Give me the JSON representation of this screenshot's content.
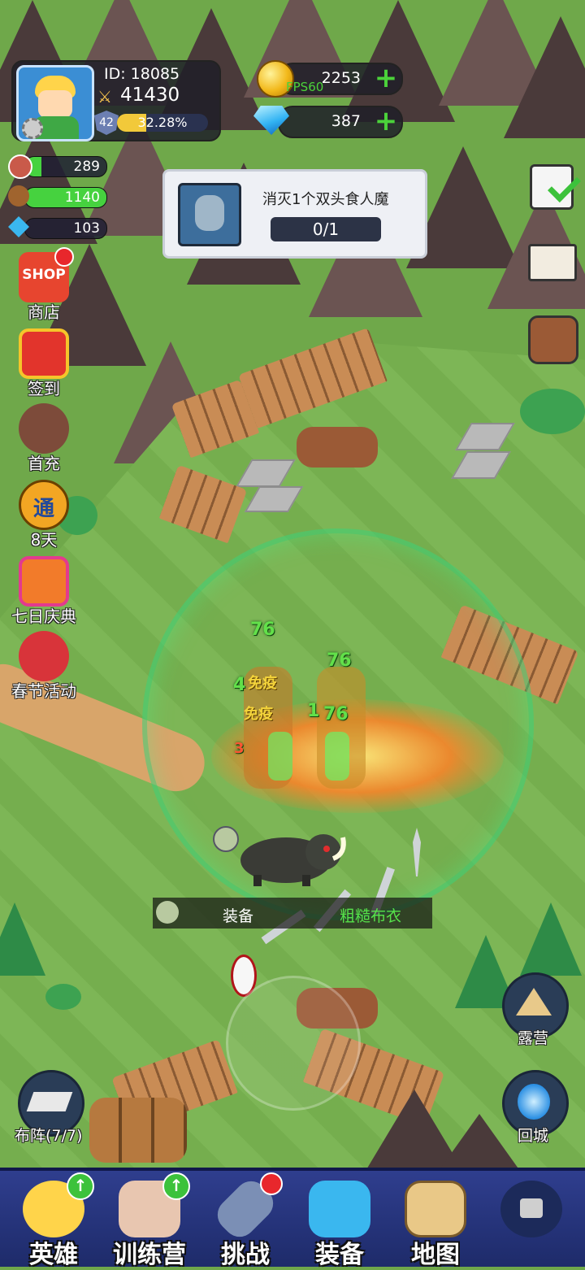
{
  "player": {
    "id_label": "ID:  18085",
    "power": "41430",
    "level": "42",
    "xp_percent_text": "32.28%",
    "xp_fraction": 0.3228
  },
  "currency": {
    "gold": "2253",
    "gems": "387",
    "fps": "FPS60"
  },
  "resources": [
    {
      "name": "meat",
      "value": "289",
      "fill": 0.2
    },
    {
      "name": "wood",
      "value": "1140",
      "fill": 1.0
    },
    {
      "name": "crystal",
      "value": "103",
      "fill": 0.0
    }
  ],
  "quest": {
    "title": "消灭1个双头食人魔",
    "progress": "0/1"
  },
  "left_menu": [
    {
      "label": "商店",
      "badge": true
    },
    {
      "label": "签到",
      "badge": false
    },
    {
      "label": "首充",
      "badge": false
    },
    {
      "label": "8天",
      "badge": false
    },
    {
      "label": "七日庆典",
      "badge": false
    },
    {
      "label": "春节活动",
      "badge": false
    }
  ],
  "shop_icon_text": "SHOP",
  "pass_icon_text": "通",
  "damage_numbers": [
    "76",
    "76",
    "4",
    "1",
    "76",
    "3"
  ],
  "status_effects": [
    "免疫",
    "免疫"
  ],
  "equip_tip": {
    "label": "装备",
    "name": "粗糙布衣"
  },
  "camp_label": "露营",
  "return_label": "回城",
  "formation_label": "布阵(7/7)",
  "bottom_nav": [
    {
      "label": "英雄",
      "badge": "up"
    },
    {
      "label": "训练营",
      "badge": "up"
    },
    {
      "label": "挑战",
      "badge": "dot"
    },
    {
      "label": "装备",
      "badge": ""
    },
    {
      "label": "地图",
      "badge": ""
    },
    {
      "label": "",
      "badge": "",
      "locked": true
    }
  ],
  "colors": {
    "accent_green": "#4bd23a",
    "nav_bg": "#2f3e8e",
    "alert_red": "#e8272c"
  }
}
